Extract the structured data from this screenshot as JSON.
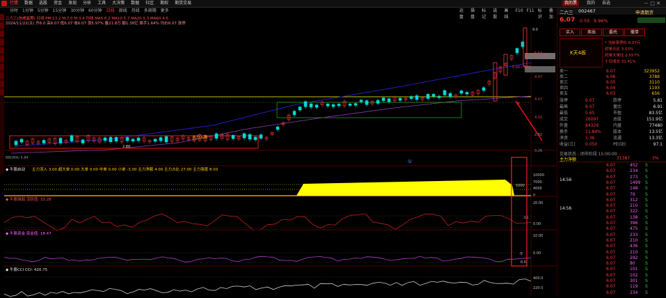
{
  "menubar": {
    "items": [
      "行情",
      "数据",
      "选股",
      "资金",
      "发现",
      "分析",
      "工具",
      "大决策",
      "数据",
      "社区",
      "期权",
      "期货交易"
    ],
    "active_index": 0,
    "right_buttons": [
      "我的票",
      "我的",
      "自选"
    ]
  },
  "toolbar": {
    "periods": [
      "分时",
      "1分钟",
      "5分钟",
      "15分钟",
      "30分钟",
      "60分钟",
      "日线",
      "周线",
      "月线",
      "多周期",
      "更多"
    ],
    "selected_period_index": 6,
    "info_line_1": "二六三(信威星期)  日线  PM:13.2 M:7.0 M:3.4  均线  MA5 6.2 MA10 5.7 MA20 5.3 MA60 4.6",
    "info_line_2": "2024/11/22(五)  开6.0 高6.07 低6.07 收6.07 涨5.97% 量21.8万 额1.38亿  换手1.64%  均价6.07  涨停",
    "right_tools": [
      "运盘",
      "操盘",
      "标记",
      "选股",
      "画线",
      "F10",
      "F11",
      "标识",
      "叠加"
    ]
  },
  "kline": {
    "price_labels": [
      "6.07",
      "5.62 - 6.35",
      "5.02 - 5.21",
      "4.97",
      "4.47",
      "4.02",
      "3.62",
      "3.26"
    ],
    "axis_labels": [
      "5.62",
      "4.97",
      "4.47",
      "4.02",
      "2.82",
      "3.26"
    ],
    "annotations": {
      "rush": "主力入场",
      "low_label": "2.80",
      "b_marks": [
        "B",
        "B",
        "B",
        "B"
      ],
      "s_marks": [
        "S",
        "S",
        "S",
        "S",
        "S",
        "S",
        "S",
        "S",
        "S"
      ],
      "si": "SI",
      "top_label": "9.0"
    },
    "indicator_line": "BBI(MA) 5.84",
    "subtitle": "首次出现跌停"
  },
  "sub1": {
    "title": "◆ 牛股启动",
    "metrics": "主力流入 3.00  超大单 0.00  大单 0.00  中单 0.00  小单 -3.00  主力净额 4.00  主力占比 27.00  主力强度 8.00",
    "axis": [
      "10000",
      "7000",
      "4000",
      "0"
    ],
    "label_right": "5000"
  },
  "sub2": {
    "title": "◆ 牛股强弱  活跃值: 33.28",
    "axis": [
      "20.00",
      "0.00"
    ],
    "label_right": "-15"
  },
  "sub3": {
    "title": "◆ 牛股资金  资金值: 18.47",
    "axis": [
      "10.00",
      "0.00"
    ],
    "label_right": "-5",
    "label_low": "0.5"
  },
  "sub4": {
    "title": "◆ 牛股CCI  CCI: 420.75",
    "axis": [
      "400.0",
      "220.0"
    ]
  },
  "panel": {
    "code": "二六三",
    "code_num": "002467",
    "tag": "申请期货",
    "price": "6.07",
    "change": "0.55",
    "pct": "9.96%",
    "buttons": [
      "买入",
      "卖出",
      "委托",
      "撤单"
    ],
    "limit_label": "K天4板",
    "notes": [
      "* 当前涨停价 6.07元",
      "封单占比 3.53%",
      "封单大单比 2.557%",
      "十日成交 31.41%"
    ],
    "order_book": [
      {
        "label": "卖一",
        "price": "6.07",
        "vol": "323952"
      },
      {
        "label": "卖二",
        "price": "6.06",
        "vol": "3789"
      },
      {
        "label": "卖三",
        "price": "6.05",
        "vol": "3110"
      },
      {
        "label": "卖四",
        "price": "6.04",
        "vol": "1193"
      },
      {
        "label": "卖五",
        "price": "6.03",
        "vol": "656"
      }
    ],
    "stats": [
      [
        "涨停",
        "6.07",
        "跌停",
        "5.81"
      ],
      [
        "最高",
        "6.07",
        "量比",
        "6.91"
      ],
      [
        "最低",
        "5.65",
        "市盈",
        "83.5亿"
      ],
      [
        "成交",
        "26097",
        "总股",
        "151.9亿"
      ],
      [
        "外盘",
        "84329",
        "内盘",
        "77480"
      ],
      [
        "换手",
        "11.84%",
        "股本",
        "13.5亿"
      ],
      [
        "净资",
        "1.36",
        "流通",
        "13.3亿"
      ],
      [
        "收益(三)",
        "0.050",
        "PE(动)",
        "97.1"
      ]
    ],
    "status_line": "交易状态 : 闭市阶段 15:00:00",
    "flow_label": "主力净额",
    "flow_value": "31387",
    "flow_pct": "3%",
    "times": [
      "14:56",
      "14:56",
      "14:56"
    ],
    "ticks": [
      [
        "14:56",
        "6.07",
        "452",
        "S"
      ],
      [
        "",
        "6.07",
        "234",
        "S"
      ],
      [
        "",
        "6.07",
        "273",
        "S"
      ],
      [
        "",
        "6.07",
        "1499",
        "S"
      ],
      [
        "",
        "6.07",
        "148",
        "S"
      ],
      [
        "",
        "6.07",
        "79",
        "S"
      ],
      [
        "",
        "6.07",
        "312",
        "S"
      ],
      [
        "",
        "6.07",
        "210",
        "S"
      ],
      [
        "",
        "6.07",
        "322",
        "S"
      ],
      [
        "",
        "6.07",
        "138",
        "S"
      ],
      [
        "",
        "6.07",
        "396",
        "S"
      ],
      [
        "",
        "6.07",
        "475",
        "S"
      ],
      [
        "",
        "6.07",
        "233",
        "S"
      ],
      [
        "",
        "6.07",
        "210",
        "S"
      ],
      [
        "",
        "6.07",
        "436",
        "S"
      ],
      [
        "",
        "6.07",
        "210",
        "S"
      ],
      [
        "",
        "6.07",
        "292",
        "S"
      ],
      [
        "",
        "6.07",
        "80",
        "S"
      ],
      [
        "",
        "6.07",
        "101",
        "S"
      ],
      [
        "",
        "6.07",
        "102",
        "S"
      ],
      [
        "",
        "6.07",
        "301",
        "S"
      ],
      [
        "",
        "6.07",
        "119",
        "S"
      ],
      [
        "",
        "6.07",
        "234",
        "S"
      ]
    ]
  },
  "colors": {
    "up": "#ff3c3c",
    "down": "#00d8d8",
    "yellow": "#ffff00",
    "bg": "#000000"
  }
}
